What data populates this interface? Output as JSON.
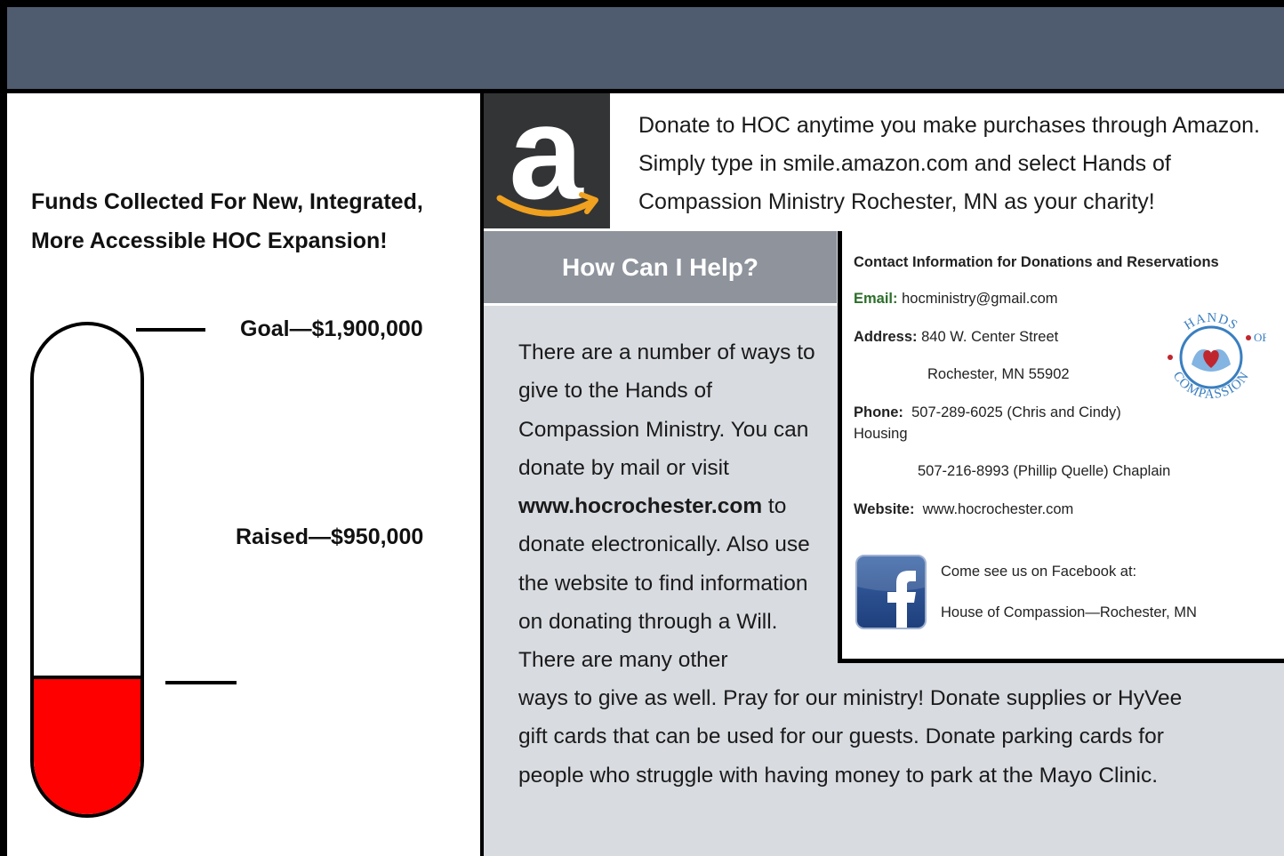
{
  "left": {
    "heading_line1": "Funds Collected For New, Integrated,",
    "heading_line2": "More Accessible HOC  Expansion!",
    "goal_label": "Goal—$1,900,000",
    "raised_label": "Raised—$950,000",
    "thermometer": {
      "goal": 1900000,
      "raised": 950000,
      "fill_color": "#ff0000"
    }
  },
  "amazon": {
    "icon": "amazon-smile-icon",
    "text": "Donate to HOC anytime you make purchases through Amazon.  Simply type in smile.amazon.com and select Hands of Compassion Ministry Rochester, MN as your charity!"
  },
  "help": {
    "title": "How Can I Help?",
    "para_a_1": "There are a number of ways to give to the Hands of Compassion Ministry.  You can donate by mail or visit ",
    "para_a_link": "www.hocrochester.com",
    "para_a_2": " to donate electronically.  Also use the website to find information on donating through a Will.  There are many other",
    "para_b": "ways to give as well.  Pray for our ministry!  Donate supplies or HyVee gift cards that can be used for our guests.  Donate parking cards for people who struggle with having money to park at the Mayo Clinic."
  },
  "contact": {
    "title": "Contact Information for Donations and Reservations",
    "email_label": "Email:",
    "email": "hocministry@gmail.com",
    "address_label": "Address:",
    "address_line1": "840 W. Center Street",
    "address_line2": "Rochester, MN 55902",
    "phone_label": "Phone:",
    "phone1": "507-289-6025 (Chris and Cindy)",
    "phone1_role": "Housing",
    "phone2": "507-216-8993 (Phillip Quelle) Chaplain",
    "website_label": "Website:",
    "website": "www.hocrochester.com",
    "logo": {
      "icon": "hands-of-compassion-logo",
      "top_text": "HANDS",
      "of_text": "OF",
      "bottom_text": "COMPASSION"
    },
    "facebook": {
      "icon": "facebook-icon",
      "line1": "Come see us on Facebook at:",
      "line2": "House of Compassion—Rochester, MN"
    }
  },
  "colors": {
    "header_bar": "#4f5b6f",
    "help_header": "#8e939c",
    "help_panel": "#d8dbe0",
    "thermometer_fill": "#ff0000",
    "email_label": "#2c6e2a"
  }
}
